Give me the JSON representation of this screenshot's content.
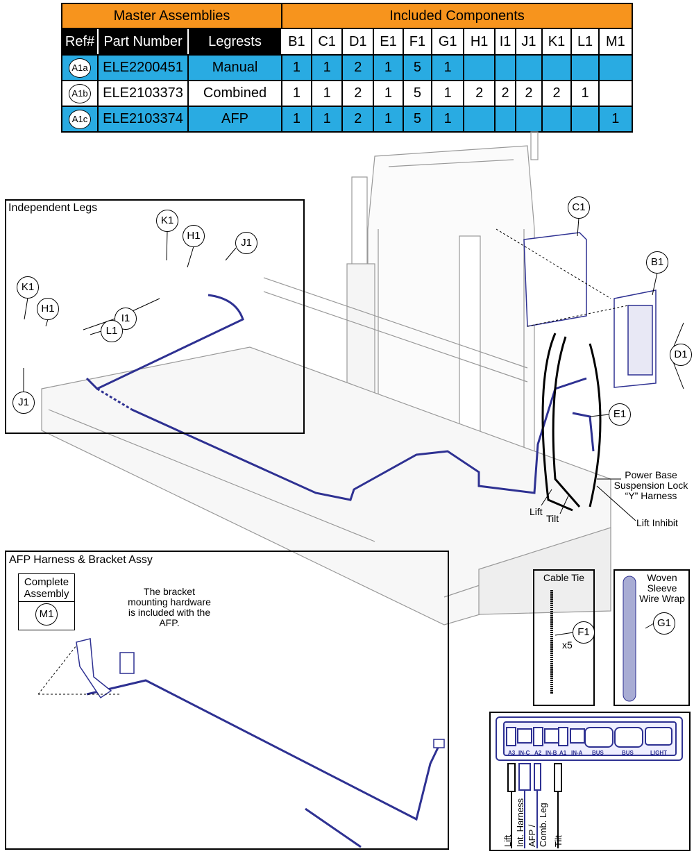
{
  "table": {
    "group_headers": {
      "master": "Master Assemblies",
      "included": "Included Components"
    },
    "columns": {
      "ref": "Ref#",
      "part_number": "Part Number",
      "legrests": "Legrests"
    },
    "components": [
      "B1",
      "C1",
      "D1",
      "E1",
      "F1",
      "G1",
      "H1",
      "I1",
      "J1",
      "K1",
      "L1",
      "M1"
    ],
    "rows": [
      {
        "ref": "A1a",
        "part_number": "ELE2200451",
        "legrests": "Manual",
        "qty": [
          "1",
          "1",
          "2",
          "1",
          "5",
          "1",
          "",
          "",
          "",
          "",
          "",
          ""
        ]
      },
      {
        "ref": "A1b",
        "part_number": "ELE2103373",
        "legrests": "Combined",
        "qty": [
          "1",
          "1",
          "2",
          "1",
          "5",
          "1",
          "2",
          "2",
          "2",
          "2",
          "1",
          ""
        ]
      },
      {
        "ref": "A1c",
        "part_number": "ELE2103374",
        "legrests": "AFP",
        "qty": [
          "1",
          "1",
          "2",
          "1",
          "5",
          "1",
          "",
          "",
          "",
          "",
          "",
          "1"
        ]
      }
    ],
    "colors": {
      "header": "#f7941d",
      "highlight_row": "#29abe2"
    }
  },
  "independent_legs": {
    "title": "Independent Legs",
    "callouts": [
      "K1",
      "H1",
      "J1",
      "K1",
      "H1",
      "I1",
      "L1",
      "J1"
    ]
  },
  "main_callouts": [
    "C1",
    "B1",
    "D1",
    "E1"
  ],
  "main_labels": {
    "y_harness": [
      "Power Base",
      "Suspension Lock",
      "“Y” Harness"
    ],
    "lift": "Lift",
    "tilt": "Tilt",
    "lift_inhibit": "Lift Inhibit"
  },
  "afp": {
    "title": "AFP Harness & Bracket Assy",
    "complete_assembly": [
      "Complete",
      "Assembly"
    ],
    "callout": "M1",
    "note": [
      "The bracket",
      "mounting hardware",
      "is included with the",
      "AFP."
    ]
  },
  "cable_tie": {
    "title": "Cable Tie",
    "callout": "F1",
    "qty": "x5"
  },
  "woven_sleeve": {
    "title": [
      "Woven",
      "Sleeve",
      "Wire Wrap"
    ],
    "callout": "G1"
  },
  "connector_panel": {
    "ports": [
      "A3",
      "IN-C",
      "A2",
      "IN-B",
      "A1",
      "IN-A",
      "BUS",
      "BUS",
      "LIGHT"
    ],
    "wires": [
      "Lift",
      "Int. Harness",
      "AFP /",
      "Comb. Leg",
      "Tilt"
    ],
    "harness_color": "#2e3192"
  }
}
